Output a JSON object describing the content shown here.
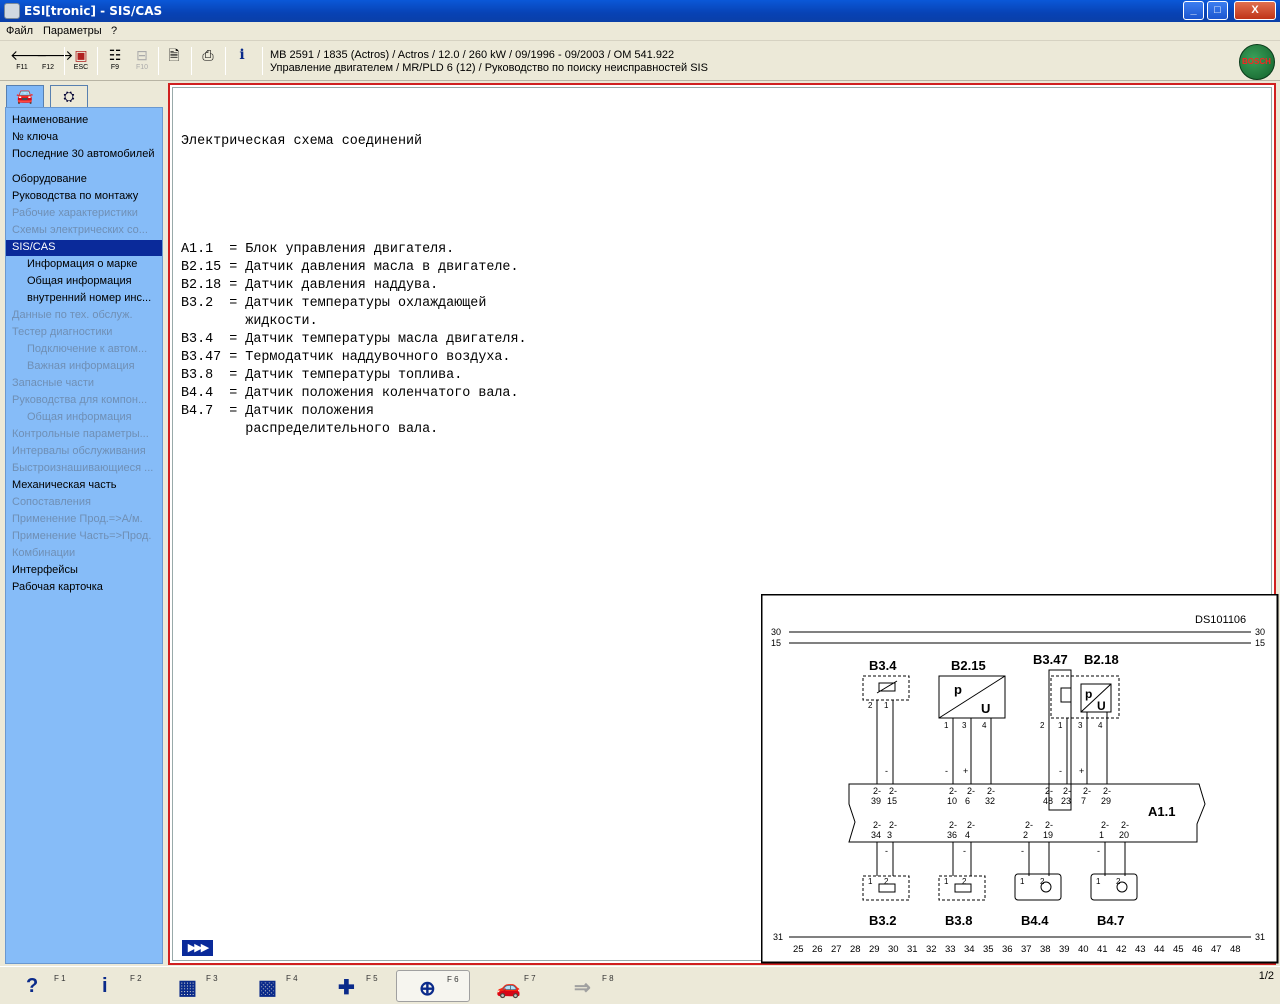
{
  "window": {
    "title": "ESI[tronic] - SIS/CAS",
    "min_label": "_",
    "max_label": "□",
    "close_label": "X"
  },
  "menu": {
    "file": "Файл",
    "params": "Параметры",
    "help": "?"
  },
  "toolbar": {
    "buttons": [
      {
        "icon": "arrow-left-icon",
        "key": "F11"
      },
      {
        "icon": "arrow-right-icon",
        "key": "F12"
      },
      {
        "icon": "exit-icon",
        "key": "ESC"
      },
      {
        "icon": "list-icon",
        "key": "F9"
      },
      {
        "icon": "tree-icon",
        "key": "F10"
      },
      {
        "icon": "document-icon",
        "key": ""
      },
      {
        "icon": "printer-icon",
        "key": ""
      },
      {
        "icon": "info-icon",
        "key": ""
      }
    ]
  },
  "vehicle": {
    "line1": "MB 2591 / 1835 (Actros) / Actros / 12.0 / 260 kW / 09/1996 - 09/2003 / OM 541.922",
    "line2": "Управление двигателем / MR/PLD 6 (12) / Руководство по поиску неисправностей SIS"
  },
  "brand": {
    "logo_text": "BOSCH"
  },
  "nav": {
    "items": [
      {
        "label": "Наименование",
        "state": "normal",
        "indent": false
      },
      {
        "label": "№ ключа",
        "state": "normal",
        "indent": false
      },
      {
        "label": "Последние 30 автомобилей",
        "state": "normal",
        "indent": false
      },
      {
        "label": "Оборудование",
        "state": "normal",
        "indent": false
      },
      {
        "label": "Руководства по монтажу",
        "state": "normal",
        "indent": false
      },
      {
        "label": "Рабочие характеристики",
        "state": "disabled",
        "indent": false
      },
      {
        "label": "Схемы электрических со...",
        "state": "disabled",
        "indent": false
      },
      {
        "label": "SIS/CAS",
        "state": "selected",
        "indent": false
      },
      {
        "label": "Информация о марке",
        "state": "normal",
        "indent": true
      },
      {
        "label": "Общая информация",
        "state": "normal",
        "indent": true
      },
      {
        "label": "внутренний номер инс...",
        "state": "normal",
        "indent": true
      },
      {
        "label": "Данные по тех. обслуж.",
        "state": "disabled",
        "indent": false
      },
      {
        "label": "Тестер диагностики",
        "state": "disabled",
        "indent": false
      },
      {
        "label": "Подключение к автом...",
        "state": "disabled",
        "indent": true
      },
      {
        "label": "Важная информация",
        "state": "disabled",
        "indent": true
      },
      {
        "label": "Запасные части",
        "state": "disabled",
        "indent": false
      },
      {
        "label": "Руководства для компон...",
        "state": "disabled",
        "indent": false
      },
      {
        "label": "Общая информация",
        "state": "disabled",
        "indent": true
      },
      {
        "label": "Контрольные параметры...",
        "state": "disabled",
        "indent": false
      },
      {
        "label": "Интервалы обслуживания",
        "state": "disabled",
        "indent": false
      },
      {
        "label": "Быстроизнашивающиеся ...",
        "state": "disabled",
        "indent": false
      },
      {
        "label": "Механическая часть",
        "state": "normal",
        "indent": false
      },
      {
        "label": "Сопоставления",
        "state": "disabled",
        "indent": false
      },
      {
        "label": "Применение Прод.=>А/м.",
        "state": "disabled",
        "indent": false
      },
      {
        "label": "Применение Часть=>Прод.",
        "state": "disabled",
        "indent": false
      },
      {
        "label": "Комбинации",
        "state": "disabled",
        "indent": false
      },
      {
        "label": "Интерфейсы",
        "state": "normal",
        "indent": false
      },
      {
        "label": "Рабочая карточка",
        "state": "normal",
        "indent": false
      }
    ]
  },
  "document": {
    "heading": "Электрическая схема соединений",
    "lines": [
      "A1.1  = Блок управления двигателя.",
      "B2.15 = Датчик давления масла в двигателе.",
      "B2.18 = Датчик давления наддува.",
      "B3.2  = Датчик температуры охлаждающей",
      "        жидкости.",
      "B3.4  = Датчик температуры масла двигателя.",
      "B3.47 = Термодатчик наддувочного воздуха.",
      "B3.8  = Датчик температуры топлива.",
      "B4.4  = Датчик положения коленчатого вала.",
      "B4.7  = Датчик положения",
      "        распределительного вала."
    ],
    "next_page_label": "▶▶▶"
  },
  "diagram": {
    "id": "DS101106",
    "rails": {
      "top1": "30",
      "top2": "15",
      "bottom": "31"
    },
    "ecu": "A1.1",
    "components_top": [
      "B3.4",
      "B2.15",
      "B3.47",
      "B2.18"
    ],
    "components_bottom": [
      "B3.2",
      "B3.8",
      "B4.4",
      "B4.7"
    ],
    "sensor_symbols": {
      "pressure_p": "p",
      "pressure_u": "U"
    },
    "ecu_pins_top": [
      [
        "2-",
        "39"
      ],
      [
        "2-",
        "15"
      ],
      [
        "2-",
        "10"
      ],
      [
        "2-",
        "6"
      ],
      [
        "2-",
        "32"
      ],
      [
        "2-",
        "48"
      ],
      [
        "2-",
        "23"
      ],
      [
        "2-",
        "7"
      ],
      [
        "2-",
        "29"
      ]
    ],
    "ecu_pins_bottom": [
      [
        "2-",
        "34"
      ],
      [
        "2-",
        "3"
      ],
      [
        "2-",
        "36"
      ],
      [
        "2-",
        "4"
      ],
      [
        "2-",
        "2"
      ],
      [
        "2-",
        "19"
      ],
      [
        "2-",
        "1"
      ],
      [
        "2-",
        "20"
      ]
    ],
    "sensor_pins_top": [
      "2",
      "1",
      "1",
      "3",
      "4",
      "2",
      "1",
      "3",
      "4"
    ],
    "sensor_pins_bottom": [
      "1",
      "2",
      "1",
      "2",
      "1",
      "2",
      "1",
      "2"
    ],
    "polarity_top": [
      "-",
      "-",
      "+",
      "-",
      "+"
    ],
    "polarity_bottom": [
      "-",
      "-",
      "-",
      "-"
    ],
    "grid_numbers": [
      "25",
      "26",
      "27",
      "28",
      "29",
      "30",
      "31",
      "32",
      "33",
      "34",
      "35",
      "36",
      "37",
      "38",
      "39",
      "40",
      "41",
      "42",
      "43",
      "44",
      "45",
      "46",
      "47",
      "48"
    ]
  },
  "bottombar": {
    "keys": [
      {
        "icon": "help-icon",
        "glyph": "?",
        "key": "F 1"
      },
      {
        "icon": "info-icon",
        "glyph": "i",
        "key": "F 2"
      },
      {
        "icon": "component-icon",
        "glyph": "▦",
        "key": "F 3"
      },
      {
        "icon": "schematic-icon",
        "glyph": "▩",
        "key": "F 4"
      },
      {
        "icon": "tester-icon",
        "glyph": "✚",
        "key": "F 5"
      },
      {
        "icon": "magnifier-icon",
        "glyph": "⊕",
        "key": "F 6"
      },
      {
        "icon": "vehicle-icon",
        "glyph": "🚗",
        "key": "F 7"
      },
      {
        "icon": "transfer-icon",
        "glyph": "⇒",
        "key": "F 8"
      }
    ],
    "page": "1/2"
  }
}
